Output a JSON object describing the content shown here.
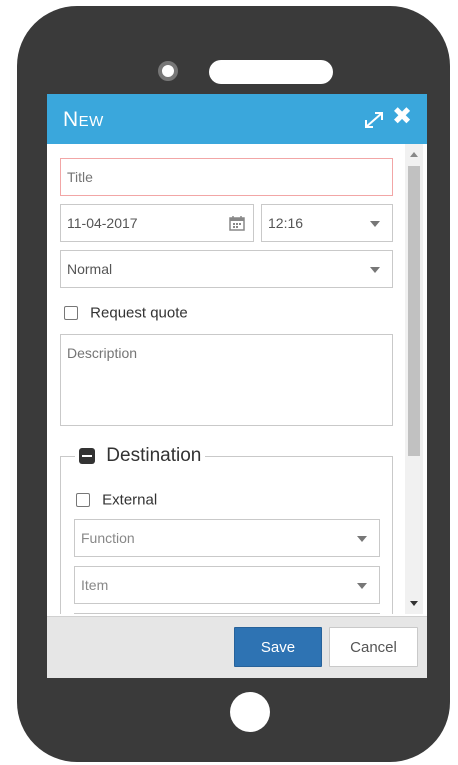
{
  "dialog": {
    "title": "New"
  },
  "form": {
    "title_placeholder": "Title",
    "date_value": "11-04-2017",
    "time_value": "12:16",
    "priority_value": "Normal",
    "request_quote_label": "Request quote",
    "request_quote_checked": false,
    "description_placeholder": "Description"
  },
  "destination": {
    "legend": "Destination",
    "external_label": "External",
    "external_checked": false,
    "function_placeholder": "Function",
    "item_placeholder": "Item"
  },
  "footer": {
    "save_label": "Save",
    "cancel_label": "Cancel"
  },
  "colors": {
    "titlebar": "#3aa7dc",
    "save_button": "#2e73b3",
    "phone_frame": "#3a3a3a",
    "title_field_border": "#f2a6a6"
  },
  "icons": {
    "maximize": "maximize-icon",
    "close": "close-icon",
    "calendar": "calendar-icon",
    "dropdown": "chevron-down-icon",
    "collapse": "collapse-icon"
  }
}
